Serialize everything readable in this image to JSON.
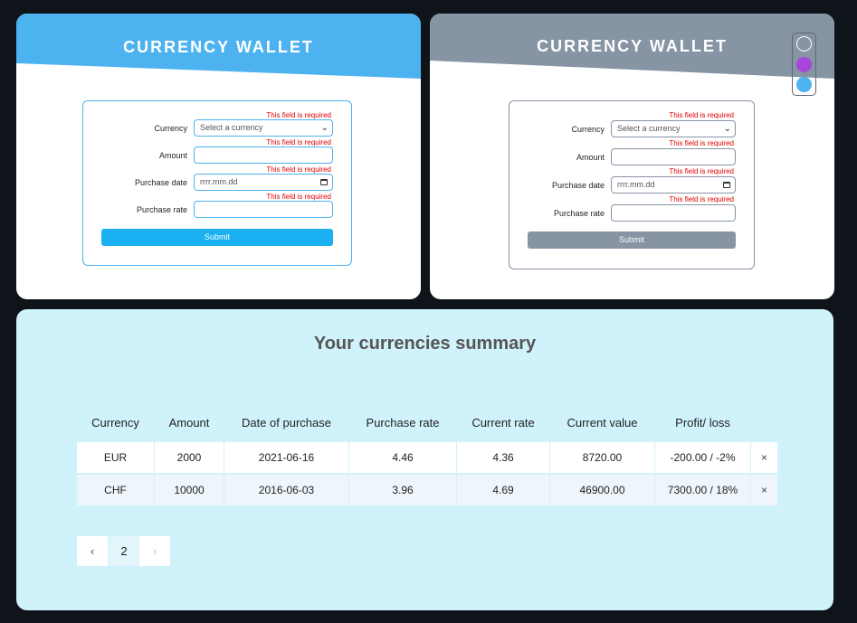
{
  "cards": {
    "blue": {
      "title": "CURRENCY WALLET",
      "error": "This field is required",
      "labels": {
        "currency": "Currency",
        "amount": "Amount",
        "purchase_date": "Purchase date",
        "purchase_rate": "Purchase rate"
      },
      "currency_placeholder": "Select a currency",
      "date_placeholder": "rrrr.mm.dd",
      "submit_label": "Submit",
      "accent": "#4db2f0"
    },
    "gray": {
      "title": "CURRENCY WALLET",
      "error": "This field is required",
      "labels": {
        "currency": "Currency",
        "amount": "Amount",
        "purchase_date": "Purchase date",
        "purchase_rate": "Purchase rate"
      },
      "currency_placeholder": "Select a currency",
      "date_placeholder": "rrrr.mm.dd",
      "submit_label": "Submit",
      "accent": "#8694a4"
    }
  },
  "theme_switcher": {
    "options": [
      "light",
      "purple",
      "blue"
    ],
    "colors": [
      "#ffffff",
      "#a547d8",
      "#4db2f0"
    ]
  },
  "summary": {
    "title": "Your currencies summary",
    "columns": [
      "Currency",
      "Amount",
      "Date of purchase",
      "Purchase rate",
      "Current rate",
      "Current value",
      "Profit/ loss"
    ],
    "rows": [
      [
        "EUR",
        "2000",
        "2021-06-16",
        "4.46",
        "4.36",
        "8720.00",
        "-200.00 / -2%"
      ],
      [
        "CHF",
        "10000",
        "2016-06-03",
        "3.96",
        "4.69",
        "46900.00",
        "7300.00 / 18%"
      ]
    ],
    "delete_glyph": "×",
    "pagination": {
      "prev": "‹",
      "page": "2",
      "next": "›"
    }
  }
}
